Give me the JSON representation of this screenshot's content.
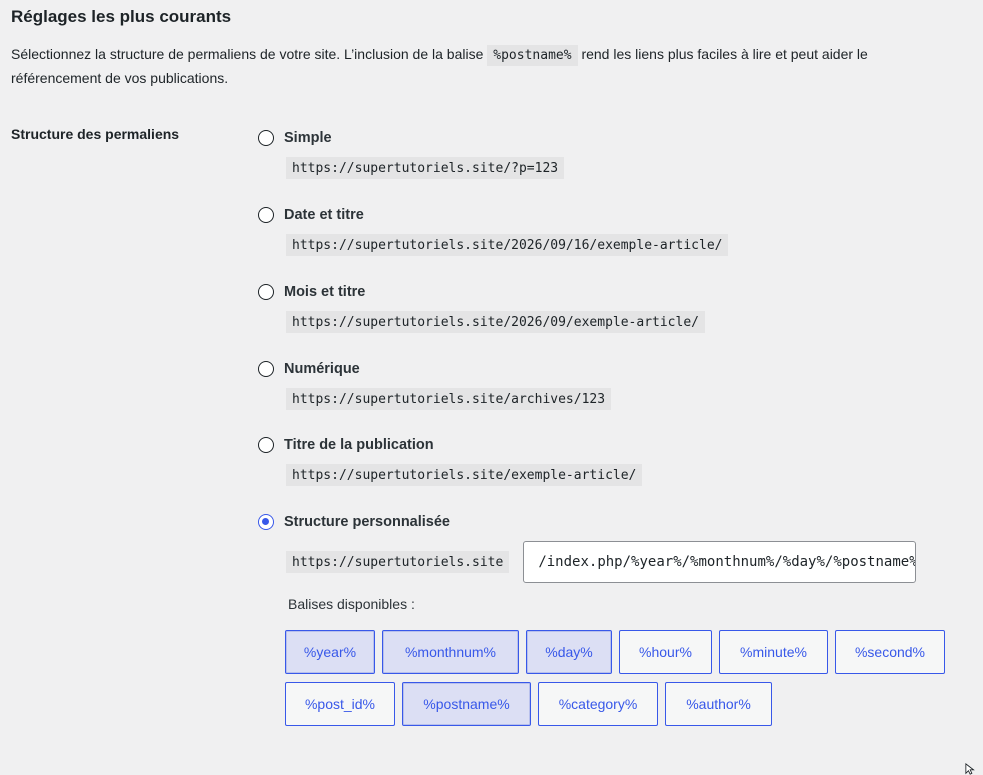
{
  "section": {
    "title": "Réglages les plus courants",
    "intro_before": "Sélectionnez la structure de permaliens de votre site. L’inclusion de la balise ",
    "intro_code": "%postname%",
    "intro_after": " rend les liens plus faciles à lire et peut aider le référencement de vos publications."
  },
  "permalinks": {
    "label": "Structure des permaliens",
    "options": [
      {
        "label": "Simple",
        "example": "https://supertutoriels.site/?p=123",
        "checked": false
      },
      {
        "label": "Date et titre",
        "example": "https://supertutoriels.site/2026/09/16/exemple-article/",
        "checked": false
      },
      {
        "label": "Mois et titre",
        "example": "https://supertutoriels.site/2026/09/exemple-article/",
        "checked": false
      },
      {
        "label": "Numérique",
        "example": "https://supertutoriels.site/archives/123",
        "checked": false
      },
      {
        "label": "Titre de la publication",
        "example": "https://supertutoriels.site/exemple-article/",
        "checked": false
      },
      {
        "label": "Structure personnalisée",
        "checked": true
      }
    ],
    "custom": {
      "prefix": "https://supertutoriels.site",
      "value": "/index.php/%year%/%monthnum%/%day%/%postname%/"
    },
    "tags_label": "Balises disponibles :",
    "tags": [
      {
        "label": "%year%",
        "active": true
      },
      {
        "label": "%monthnum%",
        "active": true
      },
      {
        "label": "%day%",
        "active": true
      },
      {
        "label": "%hour%",
        "active": false
      },
      {
        "label": "%minute%",
        "active": false
      },
      {
        "label": "%second%",
        "active": false
      },
      {
        "label": "%post_id%",
        "active": false
      },
      {
        "label": "%postname%",
        "active": true
      },
      {
        "label": "%category%",
        "active": false
      },
      {
        "label": "%author%",
        "active": false
      }
    ]
  },
  "colors": {
    "background": "#f0f0f1",
    "accent": "#3858e9",
    "tag_active_bg": "#dcdff4",
    "code_bg": "#e4e4e5"
  }
}
